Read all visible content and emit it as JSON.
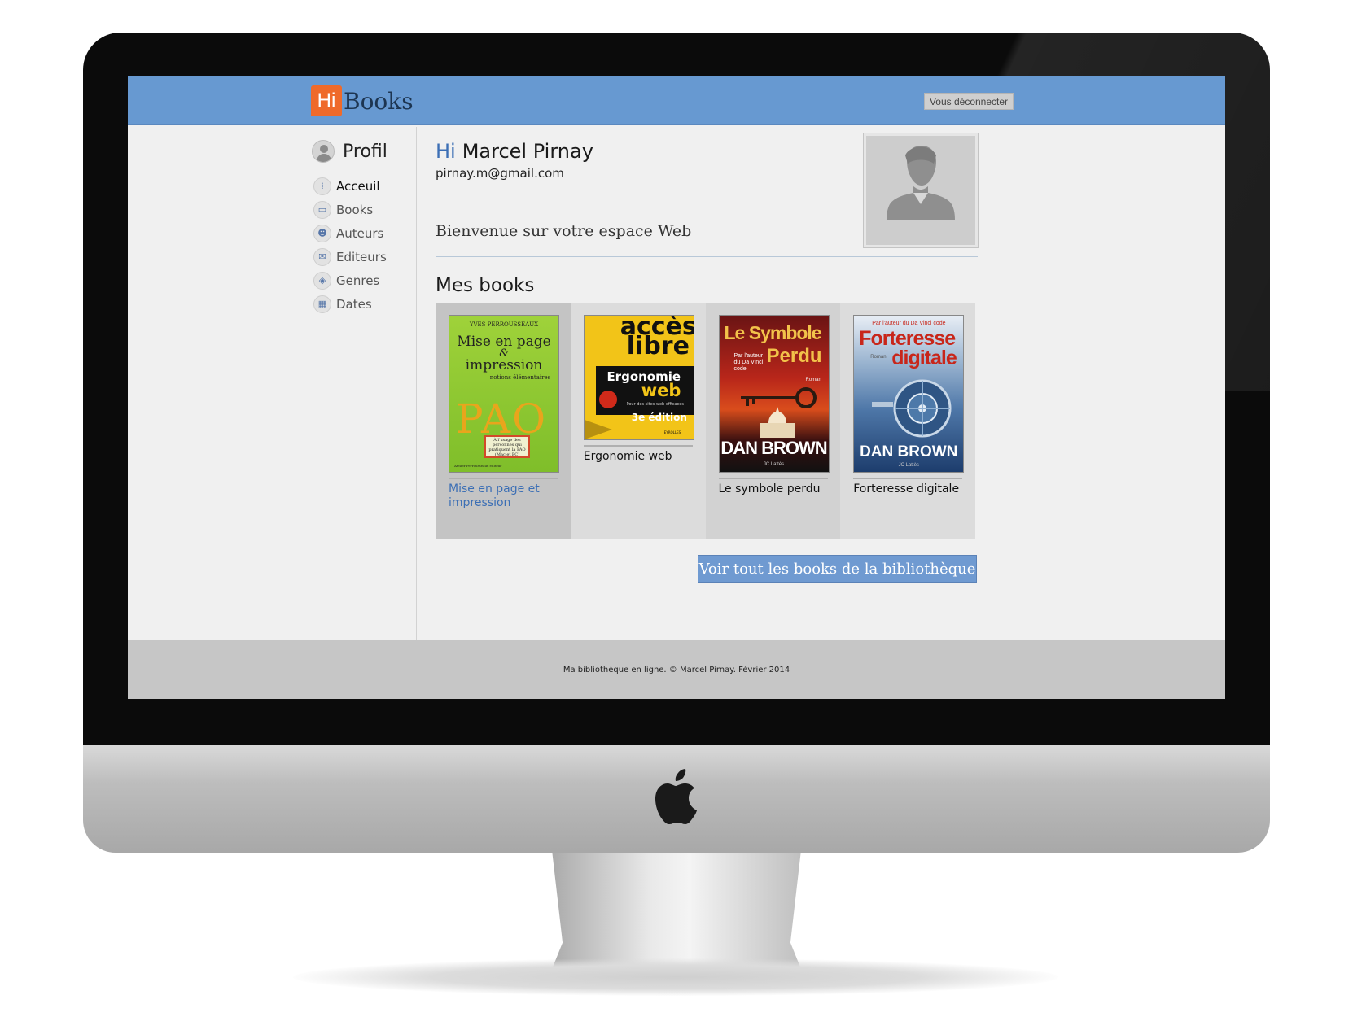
{
  "header": {
    "logo_hi": "Hi",
    "logo_books": "Books",
    "logout_label": "Vous déconnecter"
  },
  "sidebar": {
    "profile_label": "Profil",
    "items": [
      {
        "label": "Acceuil",
        "icon": "home-icon",
        "active": true
      },
      {
        "label": "Books",
        "icon": "book-icon",
        "active": false
      },
      {
        "label": "Auteurs",
        "icon": "author-icon",
        "active": false
      },
      {
        "label": "Editeurs",
        "icon": "publisher-icon",
        "active": false
      },
      {
        "label": "Genres",
        "icon": "genre-icon",
        "active": false
      },
      {
        "label": "Dates",
        "icon": "calendar-icon",
        "active": false
      }
    ]
  },
  "main": {
    "greeting_hi": "Hi",
    "user_name": "Marcel Pirnay",
    "email": "pirnay.m@gmail.com",
    "welcome": "Bienvenue sur votre espace Web",
    "section_title": "Mes books",
    "books": [
      {
        "title": "Mise en page et impression",
        "cover": {
          "author": "YVES PERROUSSEAUX",
          "line1": "Mise en page",
          "line2": "&",
          "line3": "impression",
          "subtitle": "notions élémentaires",
          "big": "PAO",
          "box": "À l'usage des personnes qui pratiquent la PAO (Mac et PC)",
          "publisher": "Atelier Perrousseaux éditeur"
        }
      },
      {
        "title": "Ergonomie web",
        "cover": {
          "top1": "accès",
          "top2": "libre",
          "line1": "Ergonomie",
          "line2": "web",
          "sub": "Pour des sites web efficaces",
          "edition": "3e édition",
          "publisher": "EYROLLES"
        }
      },
      {
        "title": "Le symbole perdu",
        "cover": {
          "line1": "Le Symbole",
          "line2": "Perdu",
          "note": "Par l'auteur du Da Vinci code",
          "genre": "Roman",
          "author": "DAN BROWN",
          "publisher": "JC Lattès"
        }
      },
      {
        "title": "Forteresse digitale",
        "cover": {
          "note": "Par l'auteur du Da Vinci code",
          "genre": "Roman",
          "line1": "Forteresse",
          "line2": "digitale",
          "author": "DAN BROWN",
          "publisher": "JC Lattès"
        }
      }
    ],
    "see_all_label": "Voir tout les books de la bibliothèque"
  },
  "footer": {
    "text": "Ma bibliothèque en ligne. © Marcel Pirnay. Février 2014"
  },
  "colors": {
    "topbar": "#6799d1",
    "logo_accent": "#ef6a2a",
    "link_blue": "#3c6fb5",
    "button": "#6f9ad1"
  }
}
